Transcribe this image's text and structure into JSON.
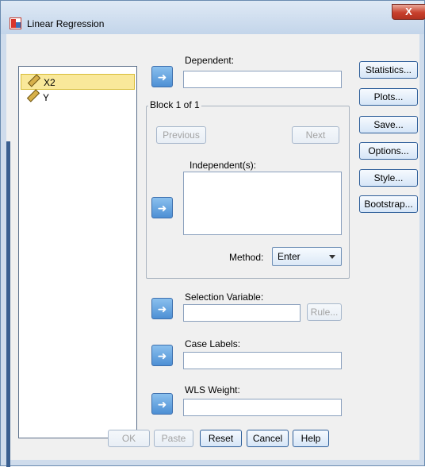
{
  "window": {
    "title": "Linear Regression",
    "close_glyph": "X",
    "app_icon": "spss-dialog-icon"
  },
  "variables": [
    {
      "name": "X2",
      "selected": true,
      "icon": "scale-ruler-icon"
    },
    {
      "name": "Y",
      "selected": false,
      "icon": "scale-ruler-icon"
    }
  ],
  "dependent": {
    "label": "Dependent:",
    "value": ""
  },
  "block": {
    "title": "Block 1 of 1",
    "previous": "Previous",
    "next": "Next",
    "independent_label": "Independent(s):",
    "method_label": "Method:",
    "method_value": "Enter"
  },
  "selection_variable": {
    "label": "Selection Variable:",
    "value": "",
    "rule": "Rule..."
  },
  "case_labels": {
    "label": "Case Labels:",
    "value": ""
  },
  "wls_weight": {
    "label": "WLS Weight:",
    "value": ""
  },
  "side_buttons": [
    "Statistics...",
    "Plots...",
    "Save...",
    "Options...",
    "Style...",
    "Bootstrap..."
  ],
  "bottom_buttons": {
    "ok": "OK",
    "paste": "Paste",
    "reset": "Reset",
    "cancel": "Cancel",
    "help": "Help"
  },
  "colors": {
    "arrow_button": "#4d8fd4",
    "selected_item": "#f9e89a",
    "close_button": "#c8402c"
  }
}
